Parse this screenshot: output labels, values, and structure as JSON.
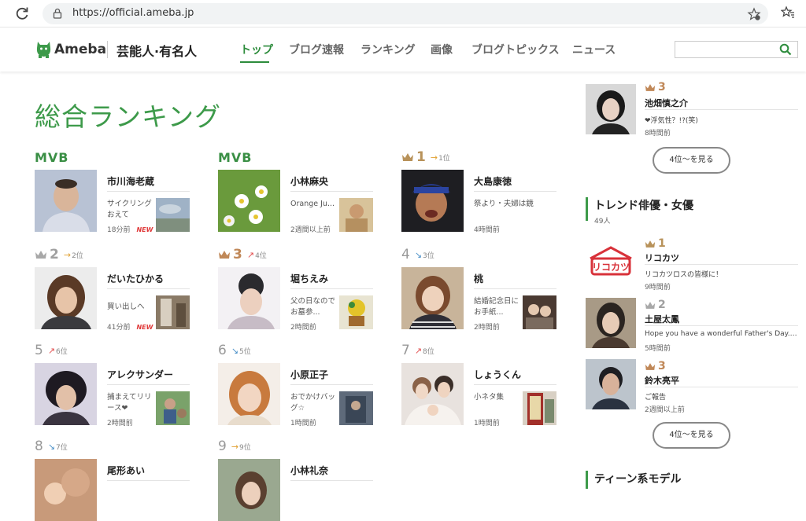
{
  "browser": {
    "url": "https://official.ameba.jp"
  },
  "header": {
    "logo_text": "Ameba",
    "site_name": "芸能人·有名人",
    "nav": [
      "トップ",
      "ブログ速報",
      "ランキング",
      "画像",
      "ブログトピックス",
      "ニュース"
    ],
    "active_nav": "トップ",
    "search": {
      "value": "",
      "placeholder": ""
    }
  },
  "page_title": "総合ランキング",
  "rankings": [
    {
      "label": "MVB",
      "badge": "mvb",
      "name": "市川海老蔵",
      "snippet": "サイクリングおえて",
      "time": "18分前",
      "new": "NEW"
    },
    {
      "label": "MVB",
      "badge": "mvb",
      "name": "小林麻央",
      "snippet": "Orange Ju...",
      "time": "2週間以上前"
    },
    {
      "label": "1",
      "badge": "gold",
      "move": "1位",
      "move_dir": "flat",
      "name": "大島康徳",
      "snippet": "祭より・夫婦は鏡",
      "time": "4時間前"
    },
    {
      "label": "2",
      "badge": "silver",
      "move": "2位",
      "move_dir": "flat",
      "name": "だいたひかる",
      "snippet": "買い出しへ",
      "time": "41分前",
      "new": "NEW"
    },
    {
      "label": "3",
      "badge": "bronze",
      "move": "4位",
      "move_dir": "up",
      "name": "堀ちえみ",
      "snippet": "父の日なのでお墓参...",
      "time": "2時間前"
    },
    {
      "label": "4",
      "badge": "plain",
      "move": "3位",
      "move_dir": "down",
      "name": "桃",
      "snippet": "結婚記念日にお手紙...",
      "time": "2時間前"
    },
    {
      "label": "5",
      "badge": "plain",
      "move": "6位",
      "move_dir": "up",
      "name": "アレクサンダー",
      "snippet": "捕まえてリリース❤",
      "time": "2時間前"
    },
    {
      "label": "6",
      "badge": "plain",
      "move": "5位",
      "move_dir": "down",
      "name": "小原正子",
      "snippet": "おでかけバッグ☆",
      "time": "1時間前"
    },
    {
      "label": "7",
      "badge": "plain",
      "move": "8位",
      "move_dir": "up",
      "name": "しょうくん",
      "snippet": "小ネタ集",
      "time": "1時間前"
    },
    {
      "label": "8",
      "badge": "plain",
      "move": "7位",
      "move_dir": "down",
      "name": "尾形あい",
      "snippet": "",
      "time": ""
    },
    {
      "label": "9",
      "badge": "plain",
      "move": "9位",
      "move_dir": "flat",
      "name": "小林礼奈",
      "snippet": "",
      "time": ""
    }
  ],
  "sidebar": {
    "top_item": {
      "rank": "3",
      "name": "池畑慎之介",
      "snippet": "❤浮気性？!?(笑)",
      "time": "8時間前"
    },
    "more_label": "4位〜を見る",
    "trend_section": {
      "title": "トレンド俳優・女優",
      "count": "49人"
    },
    "trend_items": [
      {
        "rank": "1",
        "name": "リコカツ",
        "snippet": "リコカツロスの皆様に！",
        "time": "9時間前",
        "logo_text": "リコカツ"
      },
      {
        "rank": "2",
        "name": "土屋太鳳",
        "snippet": "Hope you have a wonderful Father's Day.…",
        "time": "5時間前"
      },
      {
        "rank": "3",
        "name": "鈴木亮平",
        "snippet": "ご報告",
        "time": "2週間以上前"
      }
    ],
    "teen_section": {
      "title": "ティーン系モデル"
    }
  },
  "colors": {
    "accent": "#3d9a4a",
    "gold": "#b8925a",
    "up": "#e35050",
    "down": "#4a90c8",
    "flat": "#e0a030"
  }
}
